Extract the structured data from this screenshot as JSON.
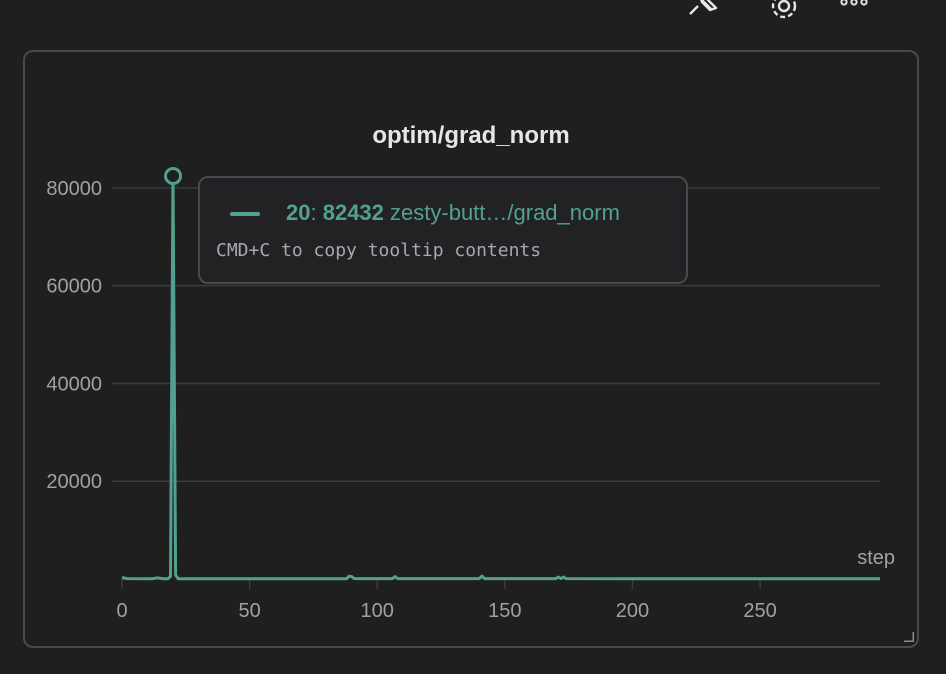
{
  "toolbar": {
    "icons": [
      "pin-icon",
      "gear-icon",
      "more-icon"
    ]
  },
  "tooltip": {
    "step": "20",
    "separator": ": ",
    "value": "82432",
    "series_label": "zesty-butt…/grad_norm",
    "hint": "CMD+C to copy tooltip contents"
  },
  "colors": {
    "series": "#52a18e",
    "grid": "#3a3a3f",
    "text": "#a0a0a6",
    "title": "#e6e6e6"
  },
  "chart_data": {
    "type": "line",
    "title": "optim/grad_norm",
    "xlabel": "step",
    "ylabel": "",
    "xlim": [
      0,
      297
    ],
    "ylim": [
      0,
      82432
    ],
    "x_ticks": [
      0,
      50,
      100,
      150,
      200,
      250
    ],
    "y_ticks": [
      20000,
      40000,
      60000,
      80000
    ],
    "grid": true,
    "series": [
      {
        "x": [
          0,
          2,
          12,
          14,
          16,
          18,
          19,
          20,
          21,
          22,
          30,
          60,
          88,
          89,
          90,
          91,
          106,
          107,
          108,
          140,
          141,
          142,
          170,
          171,
          172,
          173,
          174,
          200,
          250,
          297
        ],
        "y": [
          300,
          80,
          60,
          250,
          60,
          60,
          500,
          82432,
          800,
          60,
          60,
          60,
          60,
          600,
          500,
          80,
          80,
          500,
          80,
          80,
          600,
          80,
          80,
          400,
          80,
          400,
          80,
          60,
          60,
          60
        ]
      }
    ],
    "highlight": {
      "x": 20,
      "y": 82432
    }
  }
}
